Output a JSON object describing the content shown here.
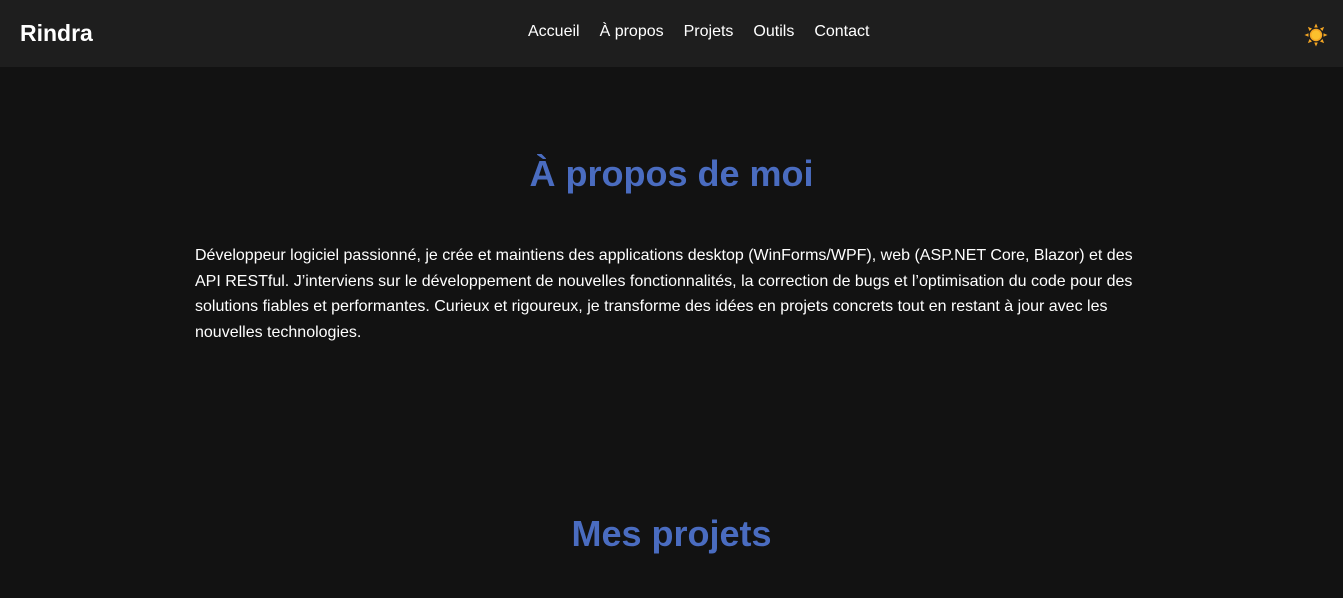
{
  "navbar": {
    "brand": "Rindra",
    "links": [
      "Accueil",
      "À propos",
      "Projets",
      "Outils",
      "Contact"
    ],
    "theme_icon": "sun-icon",
    "background": "#1e1e1e"
  },
  "about": {
    "title": "À propos de moi",
    "text": "Développeur logiciel passionné, je crée et maintiens des applications desktop (WinForms/WPF), web (ASP.NET Core, Blazor) et des API RESTful. J’interviens sur le développement de nouvelles fonctionnalités, la correction de bugs et l’optimisation du code pour des solutions fiables et performantes. Curieux et rigoureux, je transforme des idées en projets concrets tout en restant à jour avec les nouvelles technologies."
  },
  "projects": {
    "title": "Mes projets"
  },
  "colors": {
    "page_background": "#121212",
    "accent": "#4a6cc0",
    "text": "#ffffff"
  }
}
